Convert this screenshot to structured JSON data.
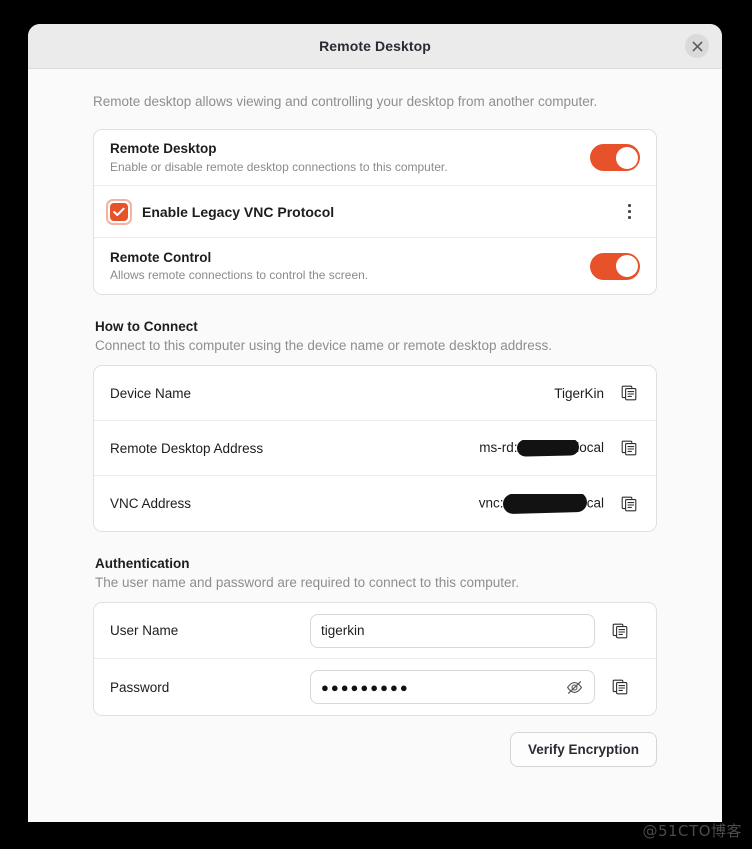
{
  "window": {
    "title": "Remote Desktop",
    "close_icon": "close-icon"
  },
  "intro": "Remote desktop allows viewing and controlling your desktop from another computer.",
  "settings": {
    "rows": [
      {
        "title": "Remote Desktop",
        "subtitle": "Enable or disable remote desktop connections to this computer.",
        "control": "toggle",
        "state": "on"
      },
      {
        "title": "Enable Legacy VNC Protocol",
        "control": "checkbox",
        "state": "checked",
        "menu_icon": "more-vertical-icon"
      },
      {
        "title": "Remote Control",
        "subtitle": "Allows remote connections to control the screen.",
        "control": "toggle",
        "state": "on"
      }
    ]
  },
  "how_to_connect": {
    "heading": "How to Connect",
    "description": "Connect to this computer using the device name or remote desktop address.",
    "rows": [
      {
        "label": "Device Name",
        "value": "TigerKin",
        "redacted": false,
        "copy_icon": "copy-icon"
      },
      {
        "label": "Remote Desktop Address",
        "value_prefix": "ms-rd:/",
        "value_suffix": "local",
        "redacted": true,
        "copy_icon": "copy-icon"
      },
      {
        "label": "VNC Address",
        "value_prefix": "vnc:/",
        "value_suffix": "ocal",
        "redacted": true,
        "copy_icon": "copy-icon"
      }
    ]
  },
  "authentication": {
    "heading": "Authentication",
    "description": "The user name and password are required to connect to this computer.",
    "username": {
      "label": "User Name",
      "value": "tigerkin",
      "placeholder": "",
      "copy_icon": "copy-icon"
    },
    "password": {
      "label": "Password",
      "masked_value": "●●●●●●●●●",
      "reveal_icon": "eye-slash-icon",
      "copy_icon": "copy-icon"
    },
    "verify_button": "Verify Encryption"
  },
  "watermark": "@51CTO博客",
  "colors": {
    "accent": "#e8522a",
    "window_bg": "#fafafa",
    "header_bg": "#ebebeb",
    "card_bg": "#ffffff",
    "text": "#1d1d20",
    "muted": "#8e8e90"
  }
}
